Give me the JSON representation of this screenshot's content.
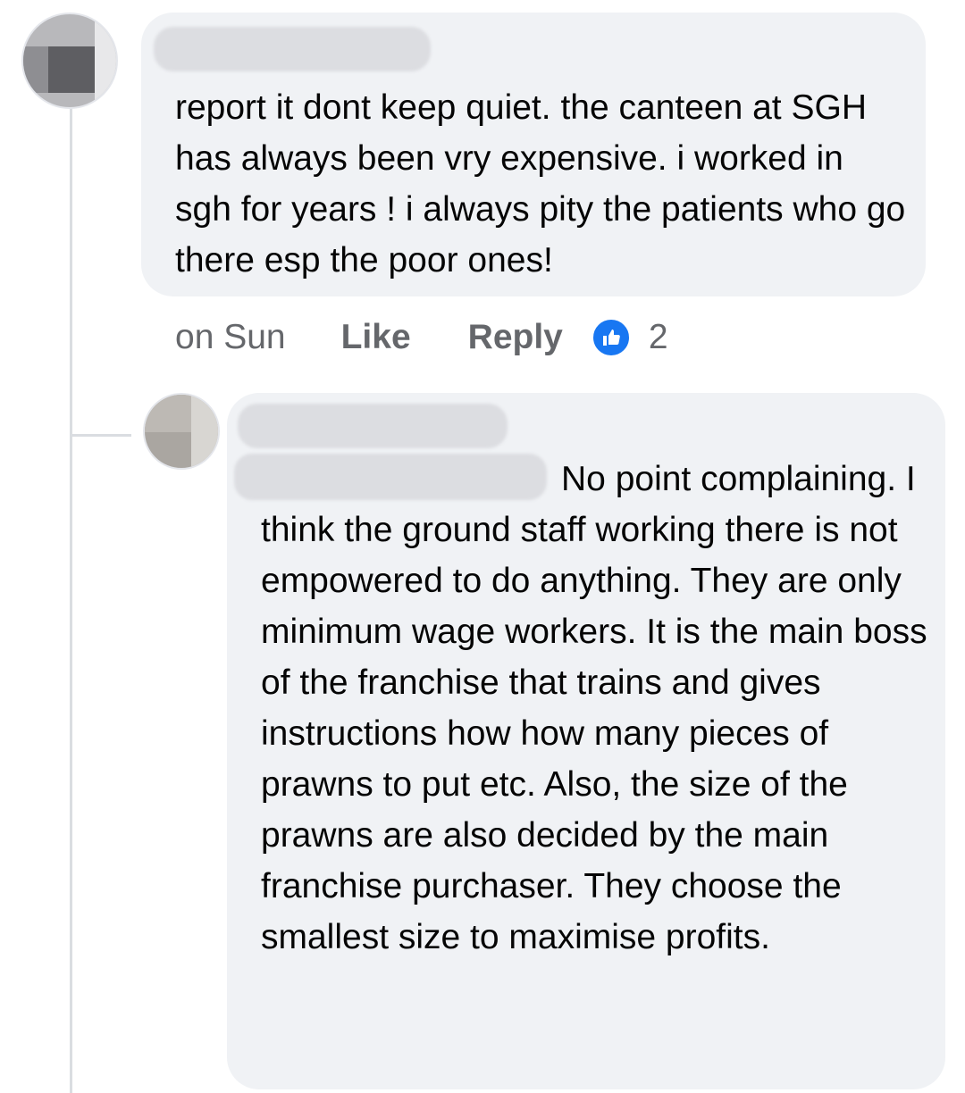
{
  "comment_1": {
    "text": "report it dont keep quiet.  the canteen at SGH has always been vry expensive. i worked in sgh for years ! i always pity the patients who go there esp the poor ones!",
    "time": "on Sun",
    "like_label": "Like",
    "reply_label": "Reply",
    "reaction_count": "2",
    "reaction_icon": "thumbs-up-icon",
    "reaction_color": "#1877f2"
  },
  "reply_1": {
    "text": "No point complaining. I think the ground staff working there is not empowered to do anything. They are only minimum wage workers. It is the main boss of the franchise that trains and gives instructions how how many pieces of prawns to put etc. Also, the size of the prawns are also decided by the main franchise purchaser. They choose the smallest size to maximise profits."
  },
  "colors": {
    "bubble_background": "#f0f2f5",
    "secondary_text": "#65676b",
    "primary_text": "#050505"
  }
}
